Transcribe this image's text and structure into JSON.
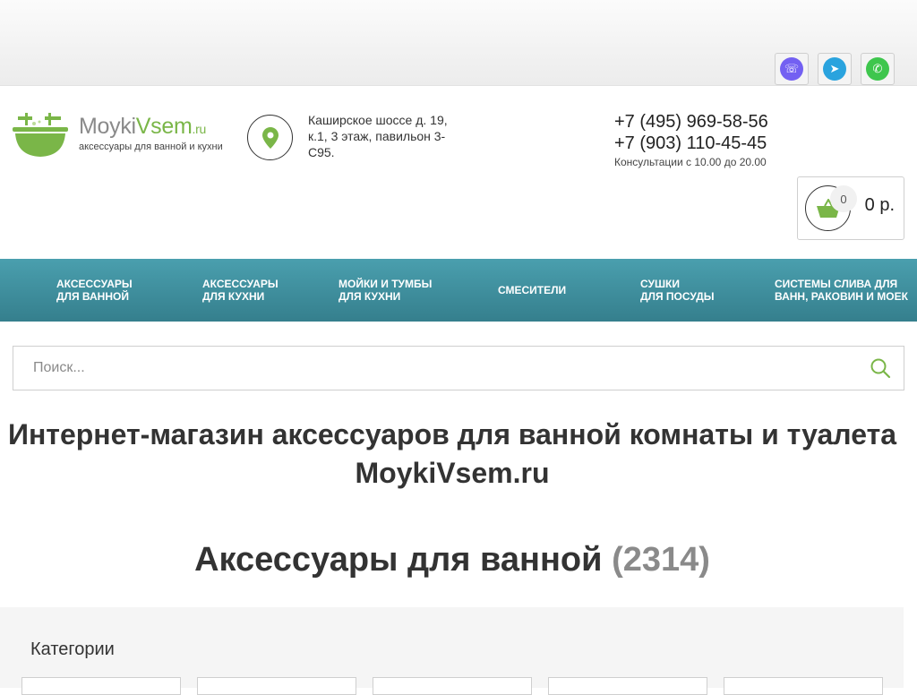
{
  "messengers": [
    {
      "name": "viber-icon",
      "glyph": "☏"
    },
    {
      "name": "telegram-icon",
      "glyph": "➤"
    },
    {
      "name": "whatsapp-icon",
      "glyph": "✆"
    }
  ],
  "logo": {
    "part1": "Moyki",
    "part2": "Vsem",
    "part3": ".ru",
    "tagline": "аксессуары для ванной и кухни"
  },
  "address": "Каширское шоссе д. 19, к.1, 3 этаж, павильон 3-С95.",
  "contacts": {
    "phone1": "+7 (495) 969-58-56",
    "phone2": "+7 (903) 110-45-45",
    "hours": "Консультации с 10.00 до 20.00"
  },
  "cart": {
    "count": "0",
    "total": "0 р."
  },
  "nav": [
    "Аксессуары\nдля ванной",
    "Аксессуары\nдля кухни",
    "Мойки и тумбы\nдля кухни",
    "Смесители",
    "Сушки\nдля посуды",
    "Системы слива для\nванн, раковин и моек"
  ],
  "search": {
    "placeholder": "Поиск..."
  },
  "page_title": "Интернет-магазин аксессуаров для ванной комнаты и туалета MoykiVsem.ru",
  "section": {
    "title": "Аксессуары для ванной",
    "count": "(2314)"
  },
  "categories": {
    "title": "Категории"
  },
  "colors": {
    "brand_green": "#7ab648",
    "nav_teal": "#3f8e9c"
  }
}
